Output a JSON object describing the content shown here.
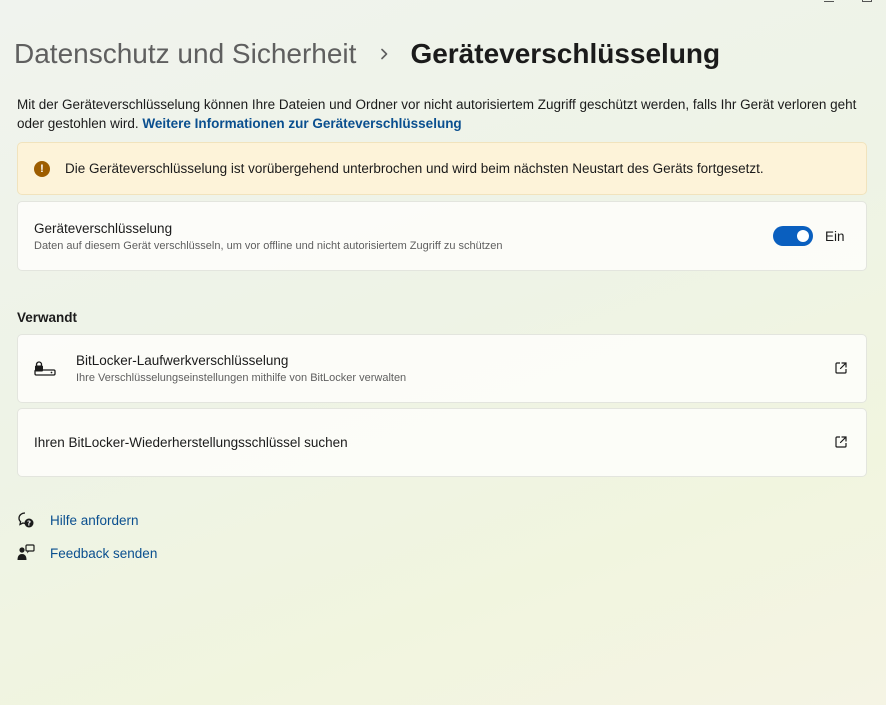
{
  "breadcrumb": {
    "parent": "Datenschutz und Sicherheit",
    "current": "Geräteverschlüsselung"
  },
  "intro": {
    "text": "Mit der Geräteverschlüsselung können Ihre Dateien und Ordner vor nicht autorisiertem Zugriff geschützt werden, falls Ihr Gerät verloren geht oder gestohlen wird.",
    "link": "Weitere Informationen zur Geräteverschlüsselung"
  },
  "warning": {
    "text": "Die Geräteverschlüsselung ist vorübergehend unterbrochen und wird beim nächsten Neustart des Geräts fortgesetzt."
  },
  "encryption": {
    "title": "Geräteverschlüsselung",
    "subtitle": "Daten auf diesem Gerät verschlüsseln, um vor offline und nicht autorisiertem Zugriff zu schützen",
    "toggle_state": "Ein"
  },
  "related": {
    "heading": "Verwandt",
    "items": [
      {
        "title": "BitLocker-Laufwerkverschlüsselung",
        "subtitle": "Ihre Verschlüsselungseinstellungen mithilfe von BitLocker verwalten"
      },
      {
        "title": "Ihren BitLocker-Wiederherstellungsschlüssel suchen"
      }
    ]
  },
  "help": {
    "get_help": "Hilfe anfordern",
    "feedback": "Feedback senden"
  },
  "colors": {
    "accent": "#0a5fbf",
    "link": "#0a4f8f",
    "warning_bg": "#fdf3d9",
    "warning_icon": "#9d5d00"
  }
}
